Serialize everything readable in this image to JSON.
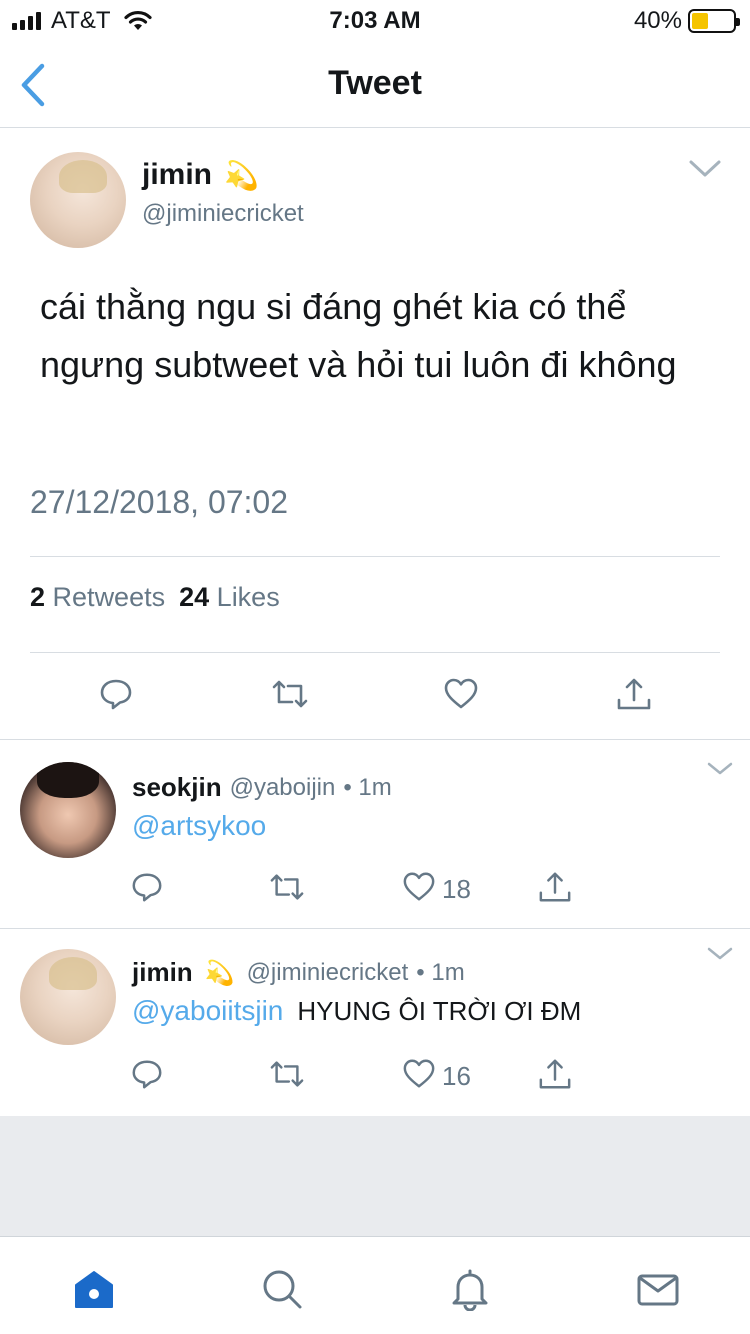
{
  "status_bar": {
    "carrier": "AT&T",
    "time": "7:03 AM",
    "battery": "40%",
    "battery_level": 0.4,
    "battery_color": "#f5c400"
  },
  "nav": {
    "title": "Tweet",
    "back_icon": "chevron-left-icon"
  },
  "main_tweet": {
    "name": "jimin",
    "name_emoji": "💫",
    "handle": "@jiminiecricket",
    "text": "cái thằng ngu si đáng ghét kia có thể ngưng subtweet và hỏi tui luôn đi không",
    "timestamp": "27/12/2018, 07:02",
    "retweets_count": "2",
    "retweets_label": "Retweets",
    "likes_count": "24",
    "likes_label": "Likes",
    "actions": [
      "reply-icon",
      "retweet-icon",
      "like-icon",
      "share-icon"
    ]
  },
  "replies": [
    {
      "name": "seokjin",
      "handle": "@yaboijin",
      "time": "• 1m",
      "mention": "@artsykoo",
      "text": "",
      "like_count": "18"
    },
    {
      "name": "jimin",
      "name_emoji": "💫",
      "handle": "@jiminiecricket",
      "time": "• 1m",
      "mention": "@yaboiitsjin",
      "text": "HYUNG ÔI TRỜI ƠI ĐM",
      "like_count": "16"
    }
  ],
  "tab_bar": {
    "tabs": [
      "home-icon",
      "search-icon",
      "notifications-icon",
      "messages-icon"
    ],
    "active_color": "#1b6ac9",
    "inactive_color": "#657786"
  },
  "colors": {
    "accent": "#55aaea",
    "secondary_text": "#657786",
    "divider": "#d8dde2"
  }
}
